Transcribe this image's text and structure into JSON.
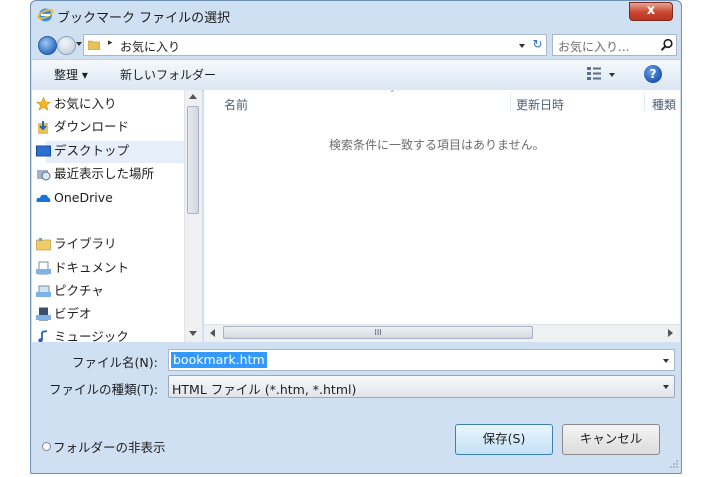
{
  "window": {
    "title": "ブックマーク ファイルの選択",
    "close_label": "x"
  },
  "address_bar": {
    "separator": "▸",
    "path": "お気に入り",
    "refresh_icon": "↻"
  },
  "search": {
    "placeholder": "お気に入り...",
    "icon": "search-icon"
  },
  "toolbar": {
    "organize_label": "整理 ▾",
    "new_folder_label": "新しいフォルダー",
    "help_label": "?"
  },
  "nav_pane": {
    "items": [
      {
        "label": "お気に入り",
        "icon": "star-icon"
      },
      {
        "label": "ダウンロード",
        "icon": "downloads-icon"
      },
      {
        "label": "デスクトップ",
        "icon": "desktop-icon",
        "selected": true
      },
      {
        "label": "最近表示した場所",
        "icon": "recent-places-icon"
      },
      {
        "label": "OneDrive",
        "icon": "onedrive-icon"
      },
      {
        "label": "ライブラリ",
        "icon": "libraries-icon"
      },
      {
        "label": "ドキュメント",
        "icon": "documents-icon"
      },
      {
        "label": "ピクチャ",
        "icon": "pictures-icon"
      },
      {
        "label": "ビデオ",
        "icon": "videos-icon"
      },
      {
        "label": "ミュージック",
        "icon": "music-icon"
      }
    ]
  },
  "file_list": {
    "columns": [
      "名前",
      "更新日時",
      "種類"
    ],
    "empty_message": "検索条件に一致する項目はありません。",
    "scroll_thumb_label": "III"
  },
  "form": {
    "filename_label": "ファイル名(N):",
    "filename_value": "bookmark.htm",
    "filetype_label": "ファイルの種類(T):",
    "filetype_value": "HTML ファイル (*.htm, *.html)"
  },
  "footer": {
    "hide_folders_label": "フォルダーの非表示",
    "save_label": "保存(S)",
    "cancel_label": "キャンセル"
  },
  "colors": {
    "frame": "#cfe0f2",
    "selection": "#3399ff",
    "close_button": "#c8462f"
  }
}
